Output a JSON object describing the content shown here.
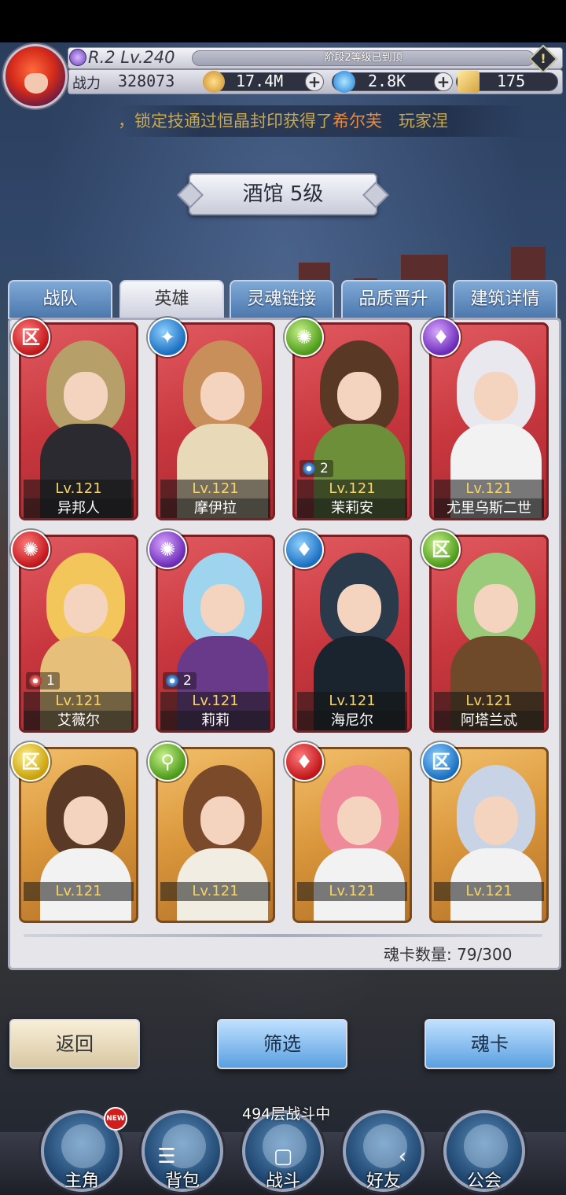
{
  "header": {
    "rank": "R.2 Lv.240",
    "stage_notice": "阶段2等级已到顶",
    "power_label": "战力",
    "power_value": "328073",
    "gold": "17.4M",
    "crystal": "2.8K",
    "tickets": "175",
    "ticker_parts": [
      "，锁定技通过恒晶封印获得了",
      "希尔芙",
      "　玩家涅"
    ]
  },
  "title": "酒馆 5级",
  "tabs": [
    "战队",
    "英雄",
    "灵魂链接",
    "品质晋升",
    "建筑详情"
  ],
  "active_tab": "英雄",
  "heroes": [
    {
      "name": "异邦人",
      "level": "Lv.121",
      "element": "red",
      "glyph": "区",
      "frame": "red",
      "hair": "#b79f6a",
      "outfit": "#2a2a30"
    },
    {
      "name": "摩伊拉",
      "level": "Lv.121",
      "element": "blue",
      "glyph": "✦",
      "frame": "red",
      "hair": "#c98f5a",
      "outfit": "#e8d9b8"
    },
    {
      "name": "茉莉安",
      "level": "Lv.121",
      "element": "green",
      "glyph": "✺",
      "frame": "red",
      "hair": "#5a3826",
      "outfit": "#6e8f3a",
      "stars": "2",
      "star_color": "blue"
    },
    {
      "name": "尤里乌斯二世",
      "level": "Lv.121",
      "element": "purple",
      "glyph": "♦",
      "frame": "red",
      "hair": "#e8e8ee",
      "outfit": "#f2f2f2"
    },
    {
      "name": "艾薇尔",
      "level": "Lv.121",
      "element": "red",
      "glyph": "✺",
      "frame": "red",
      "hair": "#f2c65a",
      "outfit": "#e6c07a",
      "stars": "1",
      "star_color": "red"
    },
    {
      "name": "莉莉",
      "level": "Lv.121",
      "element": "purple",
      "glyph": "✺",
      "frame": "red",
      "hair": "#9fd4ee",
      "outfit": "#6a3a8a",
      "stars": "2",
      "star_color": "blue"
    },
    {
      "name": "海尼尔",
      "level": "Lv.121",
      "element": "blue",
      "glyph": "♦",
      "frame": "red",
      "hair": "#2a3a4a",
      "outfit": "#1a242e"
    },
    {
      "name": "阿塔兰忒",
      "level": "Lv.121",
      "element": "green",
      "glyph": "区",
      "frame": "red",
      "hair": "#9acb7a",
      "outfit": "#6e4a2a"
    },
    {
      "name": "",
      "level": "Lv.121",
      "element": "yellow",
      "glyph": "区",
      "frame": "gold",
      "hair": "#5a3a26",
      "outfit": "#f2f2f2"
    },
    {
      "name": "",
      "level": "Lv.121",
      "element": "green",
      "glyph": "⚲",
      "frame": "gold",
      "hair": "#7a4a2a",
      "outfit": "#f2ede2"
    },
    {
      "name": "",
      "level": "Lv.121",
      "element": "red",
      "glyph": "♦",
      "frame": "gold",
      "hair": "#ee8a9a",
      "outfit": "#f2f2f2"
    },
    {
      "name": "",
      "level": "Lv.121",
      "element": "blue",
      "glyph": "区",
      "frame": "gold",
      "hair": "#c9d3e6",
      "outfit": "#f2f2f2"
    }
  ],
  "soul_count": "魂卡数量: 79/300",
  "buttons": {
    "back": "返回",
    "filter": "筛选",
    "soulcard": "魂卡"
  },
  "floor_status": "494层战斗中",
  "nav": [
    {
      "label": "主角",
      "badge": "NEW"
    },
    {
      "label": "背包"
    },
    {
      "label": "战斗"
    },
    {
      "label": "好友"
    },
    {
      "label": "公会"
    }
  ],
  "sys_nav": [
    "☰",
    "▢",
    "‹"
  ],
  "colors": {
    "tab_blue": "#4c78ad",
    "level_text": "#f6d46a",
    "ticker": "#e8c25a"
  }
}
